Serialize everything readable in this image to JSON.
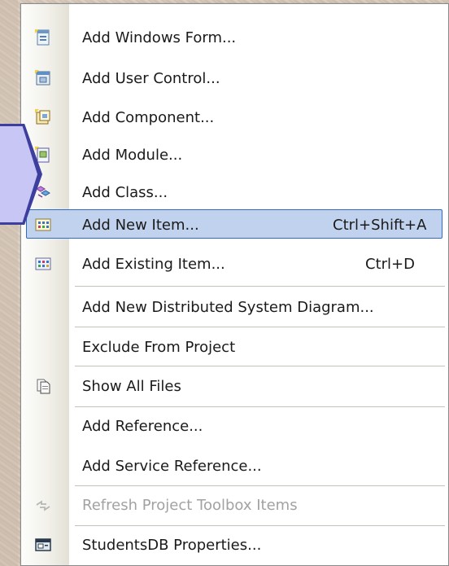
{
  "menu": {
    "items": [
      {
        "label": "Add Windows Form...",
        "shortcut": "",
        "icon": "windows-form-icon"
      },
      {
        "label": "Add User Control...",
        "shortcut": "",
        "icon": "user-control-icon"
      },
      {
        "label": "Add Component...",
        "shortcut": "",
        "icon": "component-icon"
      },
      {
        "label": "Add Module...",
        "shortcut": "",
        "icon": "module-icon"
      },
      {
        "label": "Add Class...",
        "shortcut": "",
        "icon": "class-icon"
      },
      {
        "label": "Add New Item...",
        "shortcut": "Ctrl+Shift+A",
        "icon": "new-item-icon",
        "highlighted": true
      },
      {
        "label": "Add Existing Item...",
        "shortcut": "Ctrl+D",
        "icon": "existing-item-icon"
      },
      {
        "label": "Add New Distributed System Diagram...",
        "shortcut": ""
      },
      {
        "label": "Exclude From Project",
        "shortcut": ""
      },
      {
        "label": "Show All Files",
        "shortcut": "",
        "icon": "show-all-files-icon"
      },
      {
        "label": "Add Reference...",
        "shortcut": ""
      },
      {
        "label": "Add Service Reference...",
        "shortcut": ""
      },
      {
        "label": "Refresh Project Toolbox Items",
        "shortcut": "",
        "icon": "refresh-toolbox-icon",
        "disabled": true
      },
      {
        "label": "StudentsDB Properties...",
        "shortcut": "",
        "icon": "properties-icon"
      }
    ]
  },
  "colors": {
    "highlight": "#c1d2ee",
    "highlight_border": "#316ac5",
    "pointer_fill": "#c8c6f5",
    "disabled_text": "#a2a2a2"
  }
}
